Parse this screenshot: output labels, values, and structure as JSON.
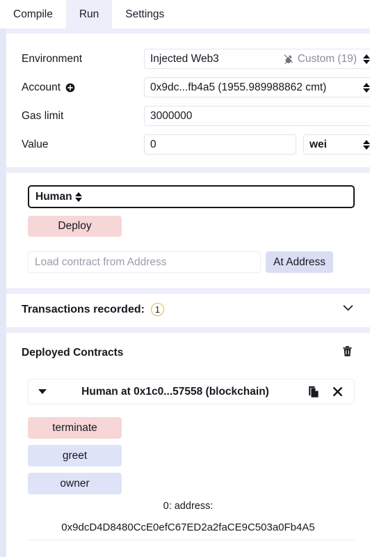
{
  "tabs": [
    {
      "label": "Compile",
      "active": false
    },
    {
      "label": "Run",
      "active": true
    },
    {
      "label": "Settings",
      "active": false
    }
  ],
  "settings": {
    "environment": {
      "label": "Environment",
      "value": "Injected Web3",
      "network": "Custom (19)",
      "icon": "plug-icon"
    },
    "account": {
      "label": "Account",
      "add_icon": "plus-circle-icon",
      "value": "0x9dc...fb4a5 (1955.989988862 cmt)"
    },
    "gas_limit": {
      "label": "Gas limit",
      "value": "3000000"
    },
    "value": {
      "label": "Value",
      "amount": "0",
      "unit": "wei"
    }
  },
  "deploy": {
    "contract": "Human",
    "deploy_label": "Deploy",
    "at_address_placeholder": "Load contract from Address",
    "at_address_value": "",
    "at_address_label": "At Address"
  },
  "transactions": {
    "label": "Transactions recorded:",
    "count": "1"
  },
  "deployed": {
    "title": "Deployed Contracts",
    "trash_icon": "trash-icon",
    "instance": {
      "name": "Human at 0x1c0...57558 (blockchain)",
      "copy_icon": "copy-icon",
      "close_icon": "close-icon",
      "caret_icon": "caret-down-icon"
    },
    "functions": [
      {
        "label": "terminate",
        "kind": "red"
      },
      {
        "label": "greet",
        "kind": "blue"
      },
      {
        "label": "owner",
        "kind": "blue"
      }
    ],
    "result": {
      "label": "0: address:",
      "value": "0x9dcD4D8480CcE0efC67ED2a2faCE9C503a0Fb4A5"
    }
  },
  "colors": {
    "page_bg": "#eceefa",
    "card_bg": "#ffffff",
    "deploy_red": "#f6d6d6",
    "action_blue": "#dfe3f7",
    "badge_gold": "#e0b83c"
  }
}
